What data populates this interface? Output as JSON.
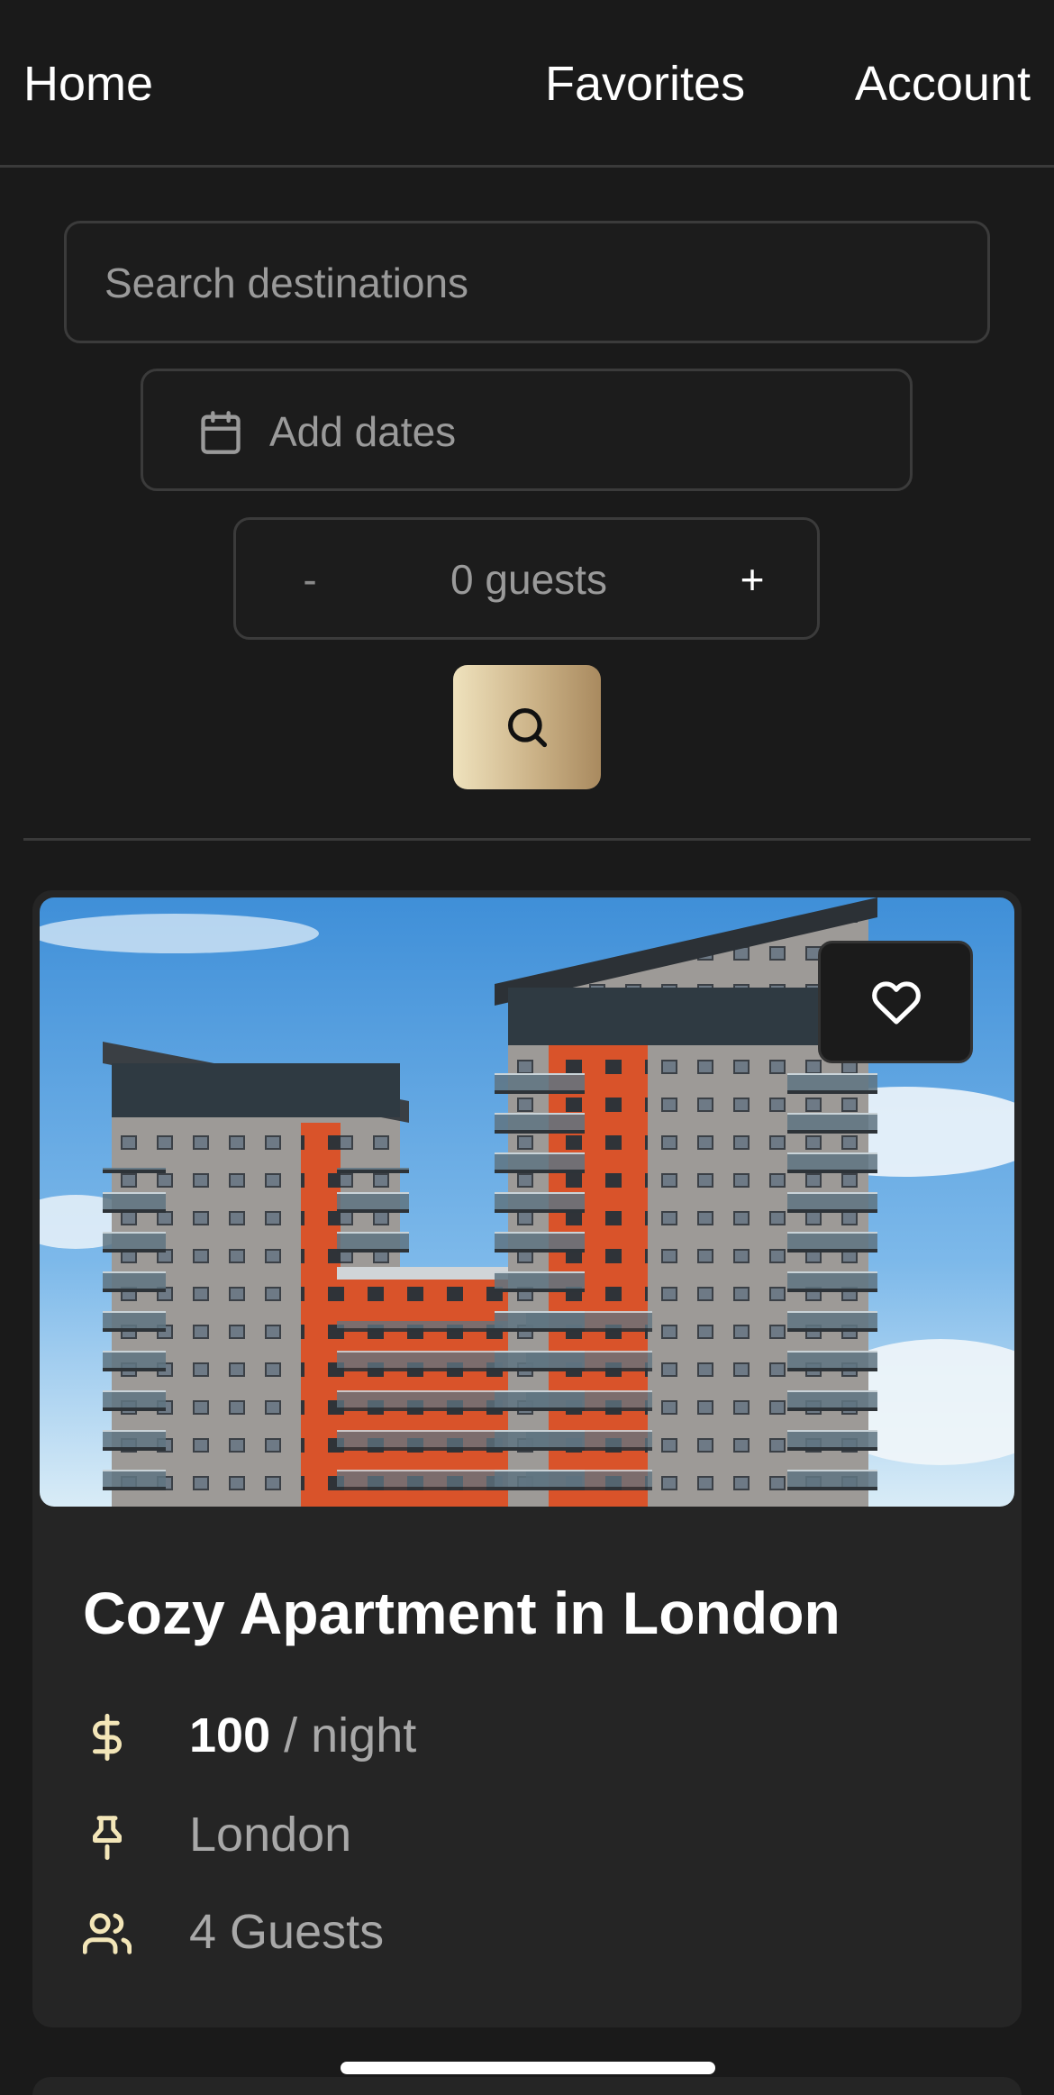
{
  "nav": {
    "home": "Home",
    "favorites": "Favorites",
    "account": "Account"
  },
  "search": {
    "destination_placeholder": "Search destinations",
    "dates_placeholder": "Add dates",
    "guests_label": "0 guests",
    "minus_label": "-",
    "plus_label": "+",
    "search_icon": "search-icon",
    "calendar_icon": "calendar-icon"
  },
  "listing": {
    "title": "Cozy Apartment in London",
    "price_value": "100",
    "price_unit": "/ night",
    "location": "London",
    "guests": "4 Guests",
    "favorite_icon": "heart-icon",
    "price_icon": "dollar-icon",
    "location_icon": "pin-icon",
    "guests_icon": "users-icon"
  },
  "colors": {
    "background": "#1a1a1a",
    "card": "#252525",
    "accent_gold": "#cbb287",
    "icon_cream": "#f3e6b8",
    "muted_text": "#a8a8a8"
  }
}
